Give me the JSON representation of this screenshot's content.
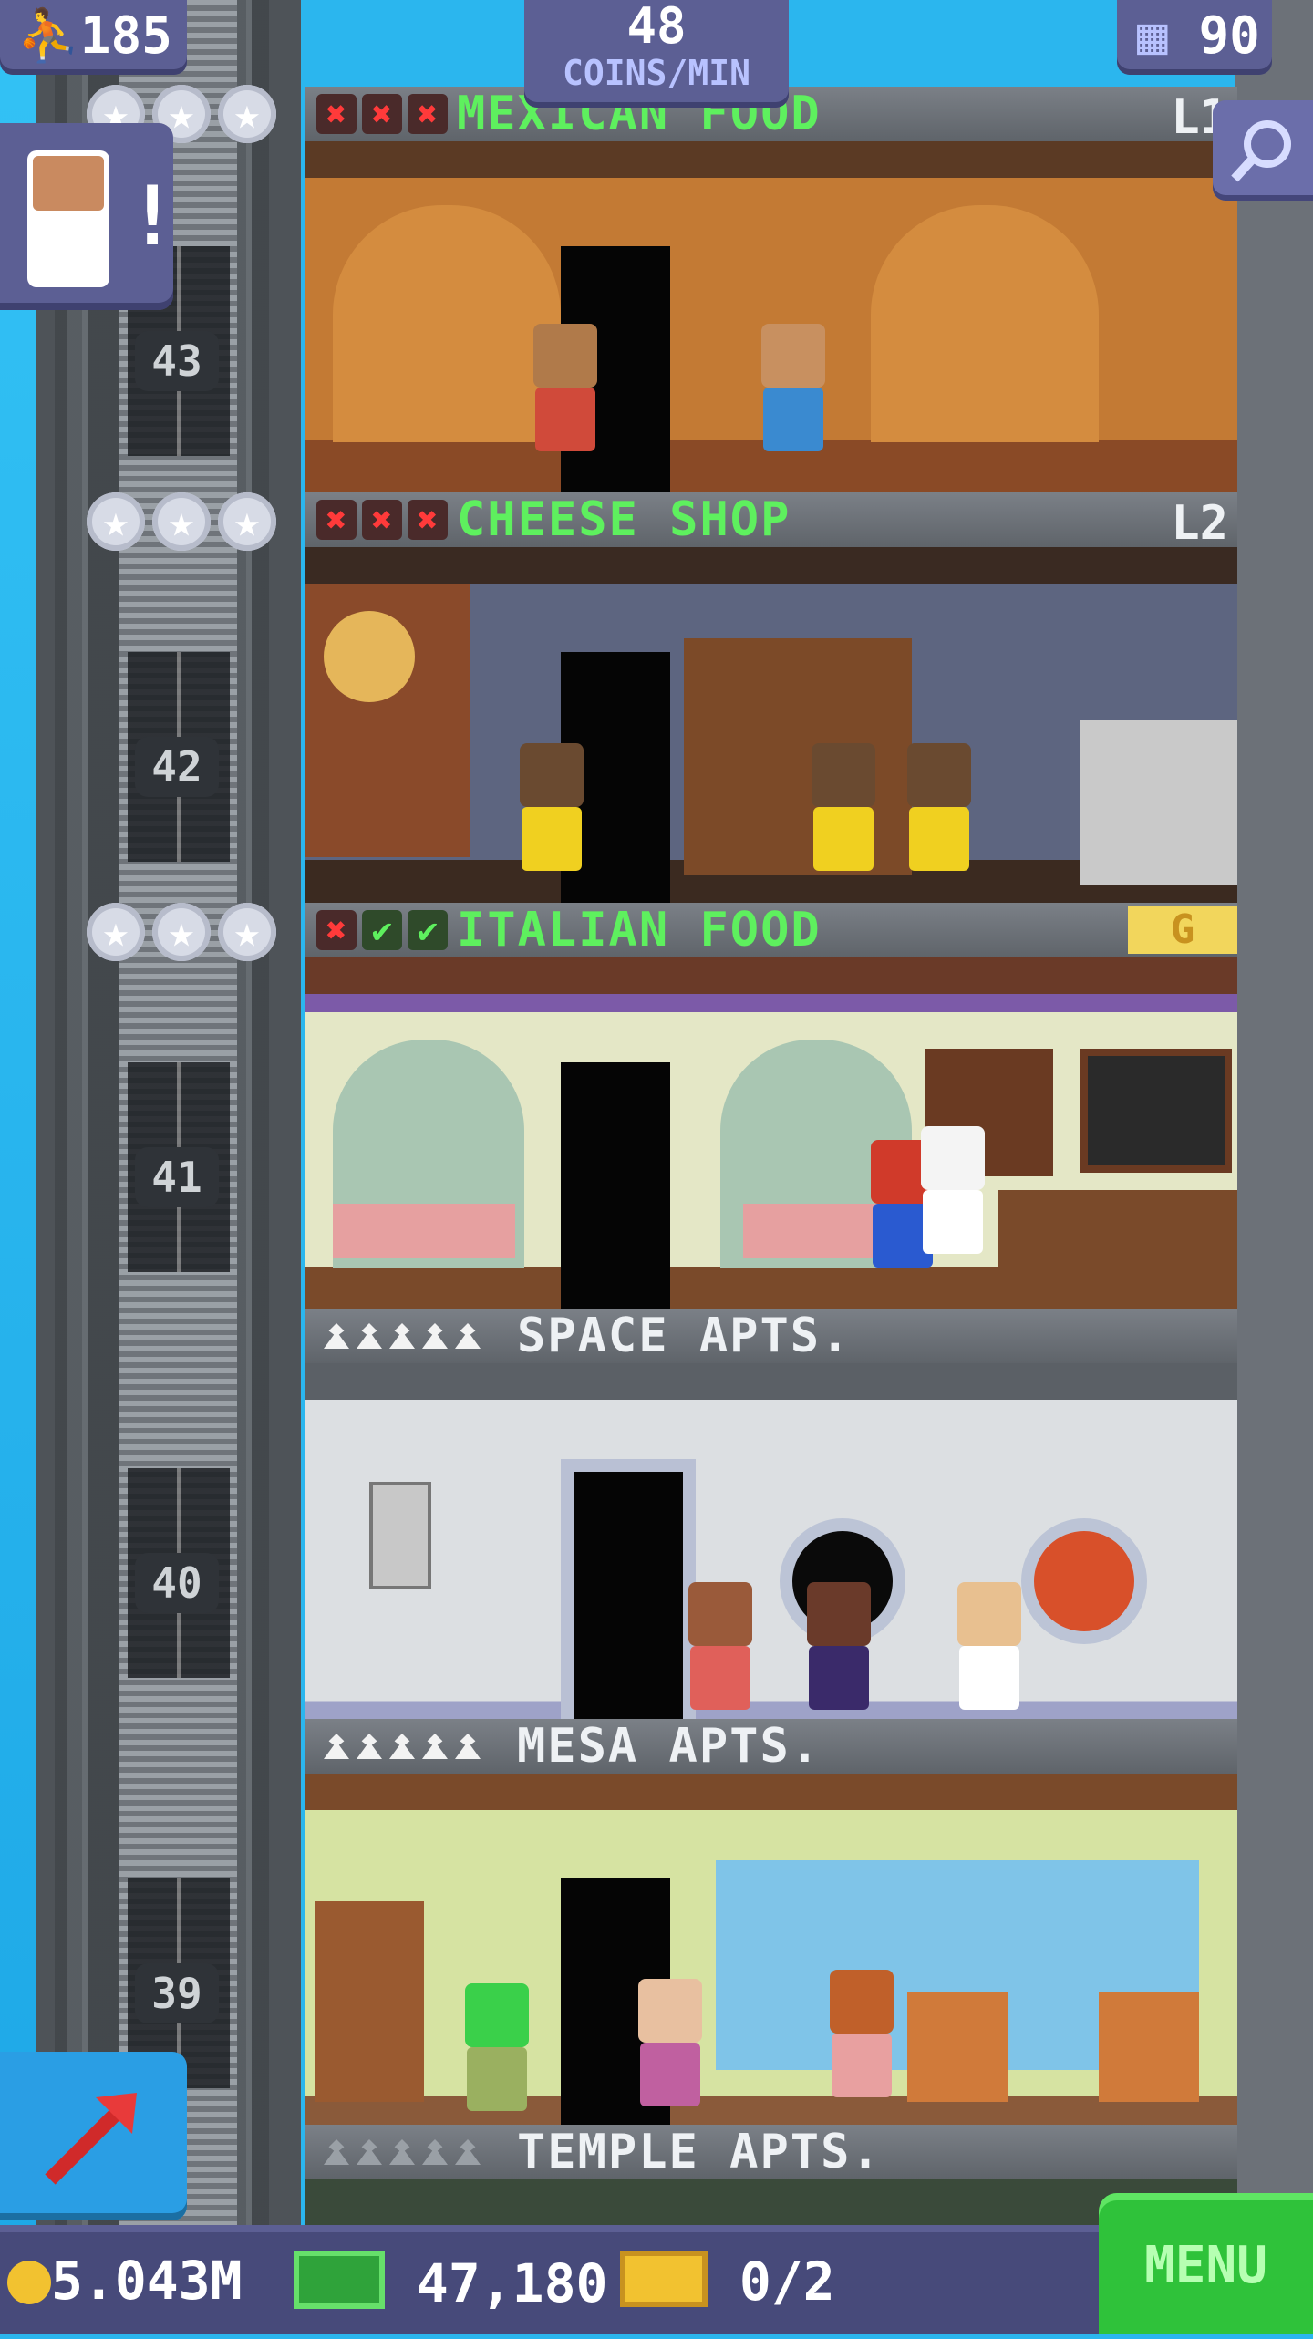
{
  "hud": {
    "population": "185",
    "coins_per_min_value": "48",
    "coins_per_min_label": "COINS/MIN",
    "floors": "90",
    "icons": [
      "population-icon",
      "building-icon",
      "search-icon"
    ]
  },
  "floors": [
    {
      "type": "commerce",
      "name": "MEXICAN FOOD",
      "level": "L1",
      "stock": [
        "x",
        "x",
        "x"
      ],
      "floor_number": "43",
      "stars": 3
    },
    {
      "type": "commerce",
      "name": "CHEESE SHOP",
      "level": "L2",
      "stock": [
        "x",
        "x",
        "x"
      ],
      "floor_number": "42",
      "stars": 3
    },
    {
      "type": "commerce",
      "name": "ITALIAN FOOD",
      "level": "G",
      "stock": [
        "x",
        "ok",
        "ok"
      ],
      "floor_number": "41",
      "stars": 3
    },
    {
      "type": "residential",
      "name": "SPACE APTS.",
      "floor_number": "40",
      "residents": 5
    },
    {
      "type": "residential",
      "name": "MESA APTS.",
      "floor_number": "39",
      "residents": 5
    },
    {
      "type": "residential",
      "name": "TEMPLE APTS.",
      "residents": 0
    }
  ],
  "bottom": {
    "coins": "5.043M",
    "bux": "47,180",
    "tickets": "0/2",
    "menu_label": "MENU"
  },
  "colors": {
    "commerce_title": "#5ef05e",
    "hud": "#5c5f94",
    "menu": "#2fc23a"
  }
}
